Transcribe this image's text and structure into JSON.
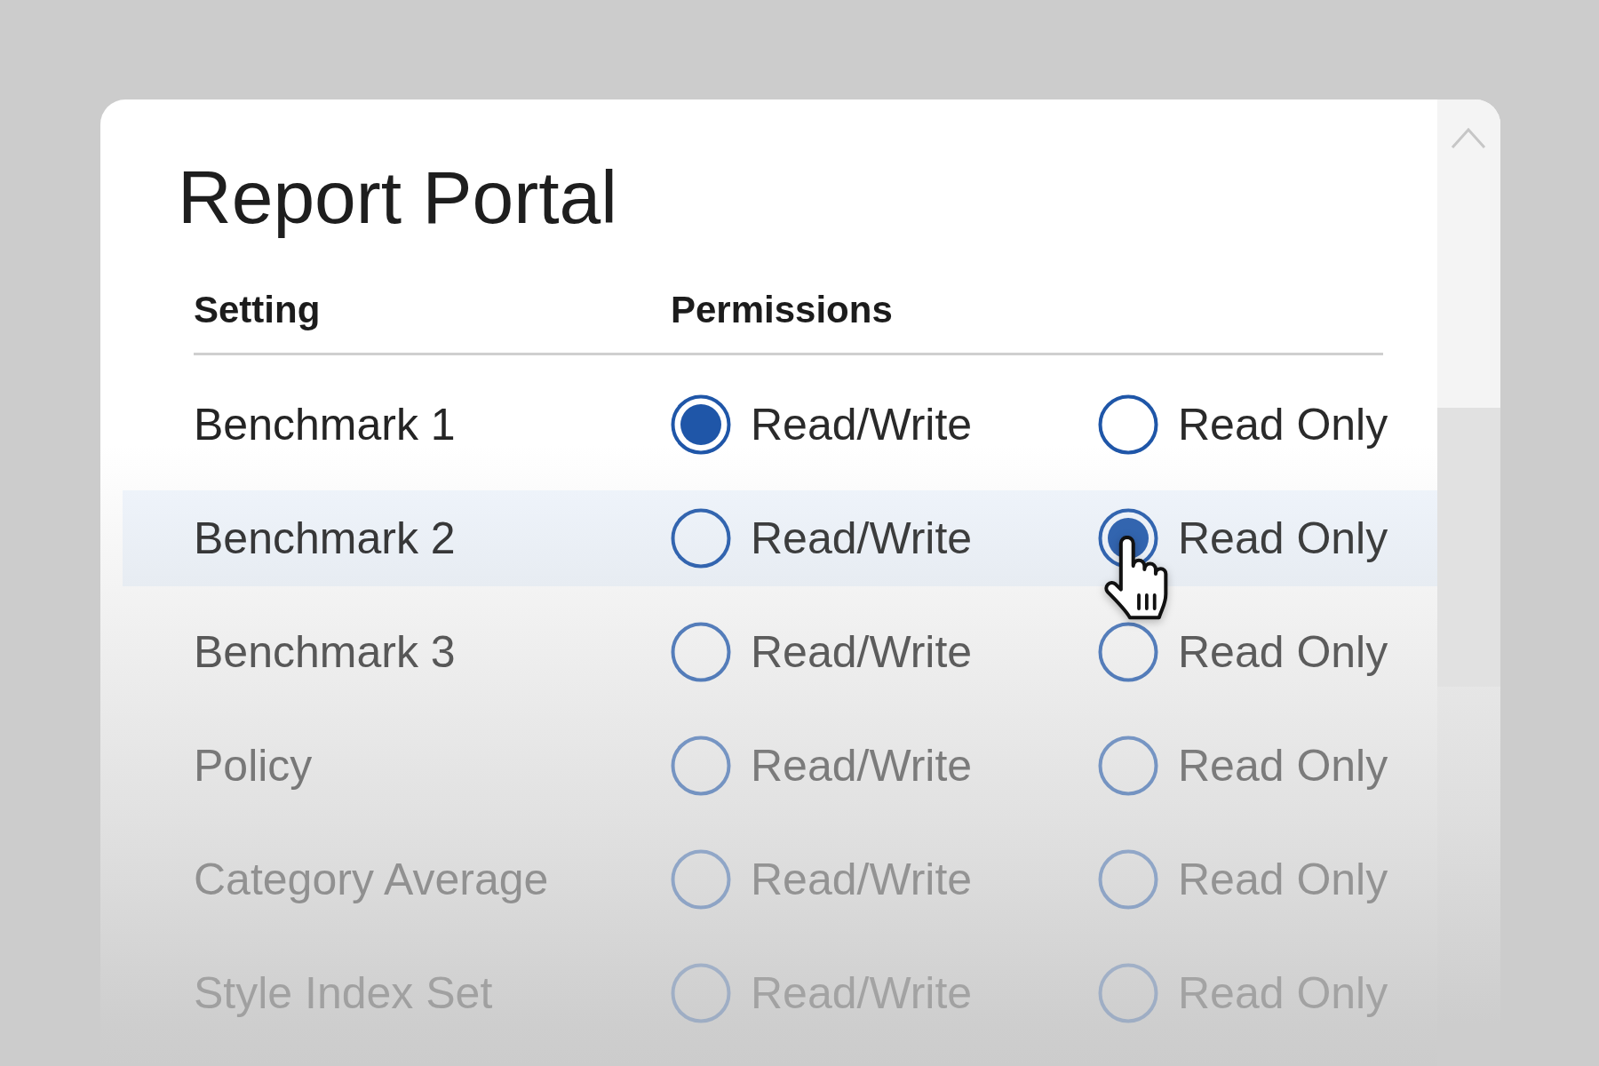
{
  "window": {
    "title": "Report Portal"
  },
  "table": {
    "columns": [
      "Setting",
      "Permissions"
    ],
    "rows": [
      {
        "setting": "Benchmark 1",
        "hovered": false,
        "options": [
          {
            "label": "Read/Write",
            "selected": true
          },
          {
            "label": "Read Only",
            "selected": false
          }
        ]
      },
      {
        "setting": "Benchmark 2",
        "hovered": true,
        "options": [
          {
            "label": "Read/Write",
            "selected": false
          },
          {
            "label": "Read Only",
            "selected": true
          }
        ]
      },
      {
        "setting": "Benchmark 3",
        "hovered": false,
        "options": [
          {
            "label": "Read/Write",
            "selected": false
          },
          {
            "label": "Read Only",
            "selected": false
          }
        ]
      },
      {
        "setting": "Policy",
        "hovered": false,
        "options": [
          {
            "label": "Read/Write",
            "selected": false
          },
          {
            "label": "Read Only",
            "selected": false
          }
        ]
      },
      {
        "setting": "Category Average",
        "hovered": false,
        "options": [
          {
            "label": "Read/Write",
            "selected": false
          },
          {
            "label": "Read Only",
            "selected": false
          }
        ]
      },
      {
        "setting": "Style Index Set",
        "hovered": false,
        "options": [
          {
            "label": "Read/Write",
            "selected": false
          },
          {
            "label": "Read Only",
            "selected": false
          }
        ]
      }
    ]
  }
}
